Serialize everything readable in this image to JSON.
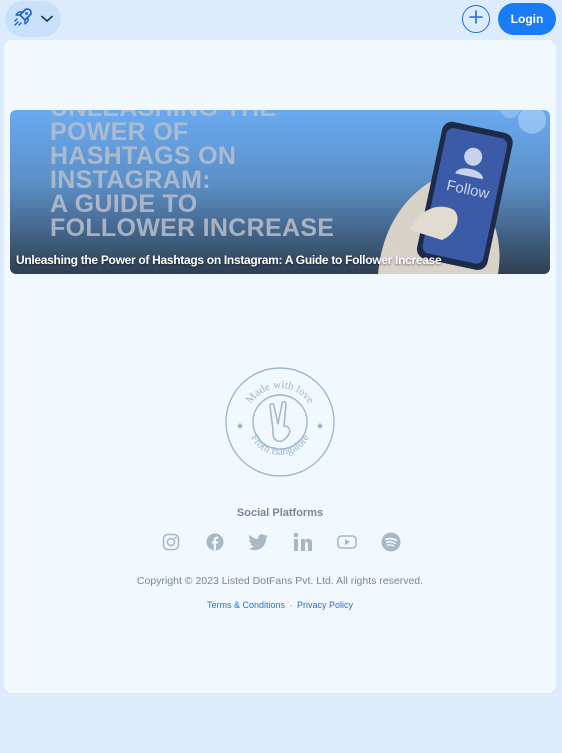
{
  "header": {
    "logo_icon": "rocket-icon",
    "dropdown_icon": "chevron-down-icon",
    "add_icon": "plus-icon",
    "login_label": "Login",
    "accent": "#1a7cf5"
  },
  "article": {
    "hero_lines": [
      "UNLEASHING THE",
      "POWER OF",
      "HASHTAGS ON",
      "INSTAGRAM:",
      "A GUIDE TO",
      "FOLLOWER INCREASE"
    ],
    "phone_label": "Follow",
    "title": "Unleashing the Power of Hashtags on Instagram: A Guide to Follower Increase"
  },
  "stamp": {
    "top_text": "Made with love",
    "bottom_text": "From Bangalore"
  },
  "footer": {
    "social_title": "Social Platforms",
    "social_icons": [
      "instagram-icon",
      "facebook-icon",
      "twitter-icon",
      "linkedin-icon",
      "youtube-icon",
      "spotify-icon"
    ],
    "copyright": "Copyright © 2023 Listed DotFans Pvt. Ltd. All rights reserved.",
    "terms": "Terms & Conditions",
    "separator": "·",
    "privacy": "Privacy Policy"
  }
}
